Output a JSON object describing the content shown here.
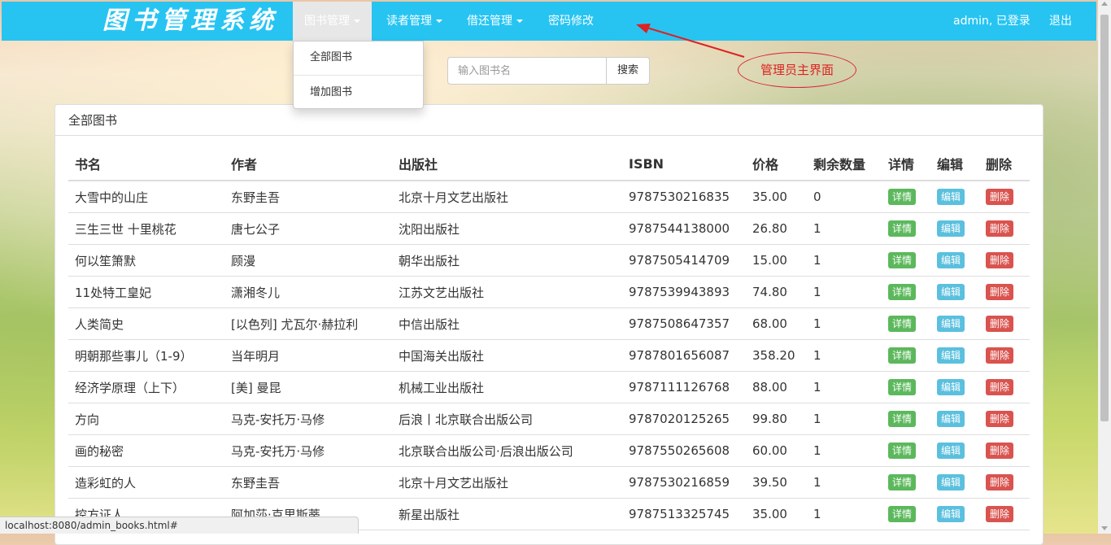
{
  "navbar": {
    "brand": "图书管理系统",
    "items": [
      {
        "label": "图书管理",
        "has_caret": true
      },
      {
        "label": "读者管理",
        "has_caret": true
      },
      {
        "label": "借还管理",
        "has_caret": true
      },
      {
        "label": "密码修改",
        "has_caret": false
      }
    ],
    "user_status": "admin, 已登录",
    "logout": "退出"
  },
  "dropdown": {
    "items": [
      "全部图书",
      "增加图书"
    ]
  },
  "search": {
    "placeholder": "输入图书名",
    "button_label": "搜索"
  },
  "annotation": {
    "text": "管理员主界面"
  },
  "panel": {
    "title": "全部图书",
    "columns": [
      "书名",
      "作者",
      "出版社",
      "ISBN",
      "价格",
      "剩余数量",
      "详情",
      "编辑",
      "删除"
    ],
    "action_labels": {
      "detail": "详情",
      "edit": "编辑",
      "delete": "删除"
    },
    "rows": [
      [
        "大雪中的山庄",
        "东野圭吾",
        "北京十月文艺出版社",
        "9787530216835",
        "35.00",
        "0"
      ],
      [
        "三生三世 十里桃花",
        "唐七公子",
        "沈阳出版社",
        "9787544138000",
        "26.80",
        "1"
      ],
      [
        "何以笙箫默",
        "顾漫",
        "朝华出版社",
        "9787505414709",
        "15.00",
        "1"
      ],
      [
        "11处特工皇妃",
        "潇湘冬儿",
        "江苏文艺出版社",
        "9787539943893",
        "74.80",
        "1"
      ],
      [
        "人类简史",
        "[以色列] 尤瓦尔·赫拉利",
        "中信出版社",
        "9787508647357",
        "68.00",
        "1"
      ],
      [
        "明朝那些事儿（1-9）",
        "当年明月",
        "中国海关出版社",
        "9787801656087",
        "358.20",
        "1"
      ],
      [
        "经济学原理（上下）",
        "[美] 曼昆",
        "机械工业出版社",
        "9787111126768",
        "88.00",
        "1"
      ],
      [
        "方向",
        "马克-安托万·马修",
        "后浪丨北京联合出版公司",
        "9787020125265",
        "99.80",
        "1"
      ],
      [
        "画的秘密",
        "马克-安托万·马修",
        "北京联合出版公司·后浪出版公司",
        "9787550265608",
        "60.00",
        "1"
      ],
      [
        "造彩虹的人",
        "东野圭吾",
        "北京十月文艺出版社",
        "9787530216859",
        "39.50",
        "1"
      ],
      [
        "控方证人",
        "阿加莎·克里斯蒂",
        "新星出版社",
        "9787513325745",
        "35.00",
        "1"
      ]
    ]
  },
  "status_bar": {
    "url": "localhost:8080/admin_books.html#"
  },
  "colors": {
    "navbar": "#27c4f2",
    "detail_button": "#5cb85c",
    "edit_button": "#5bc0de",
    "delete_button": "#d9534f",
    "annotation": "#dd2222"
  }
}
